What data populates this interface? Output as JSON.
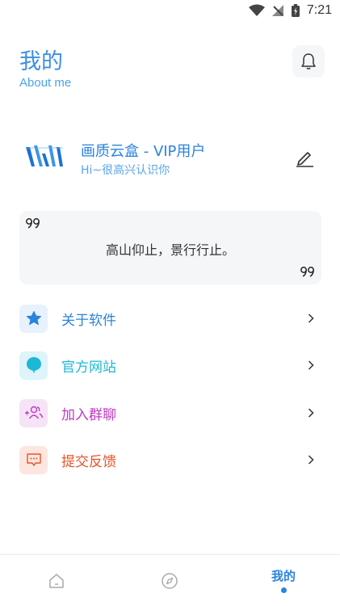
{
  "status_bar": {
    "time": "7:21"
  },
  "header": {
    "title": "我的",
    "subtitle": "About me"
  },
  "profile": {
    "name": "画质云盒 - VIP用户",
    "greeting": "Hi~很高兴认识你"
  },
  "quote": {
    "text": "高山仰止，景行行止。"
  },
  "menu": [
    {
      "label": "关于软件",
      "icon": "star-icon",
      "color": "#2b83dd",
      "bg": "#e8f2fc"
    },
    {
      "label": "官方网站",
      "icon": "bubble-icon",
      "color": "#1db8d6",
      "bg": "#dcf4fa"
    },
    {
      "label": "加入群聊",
      "icon": "group-add-icon",
      "color": "#c238c6",
      "bg": "#f5e3f6"
    },
    {
      "label": "提交反馈",
      "icon": "feedback-icon",
      "color": "#e5552b",
      "bg": "#fde6e0"
    }
  ],
  "bottom_nav": {
    "active_label": "我的"
  }
}
